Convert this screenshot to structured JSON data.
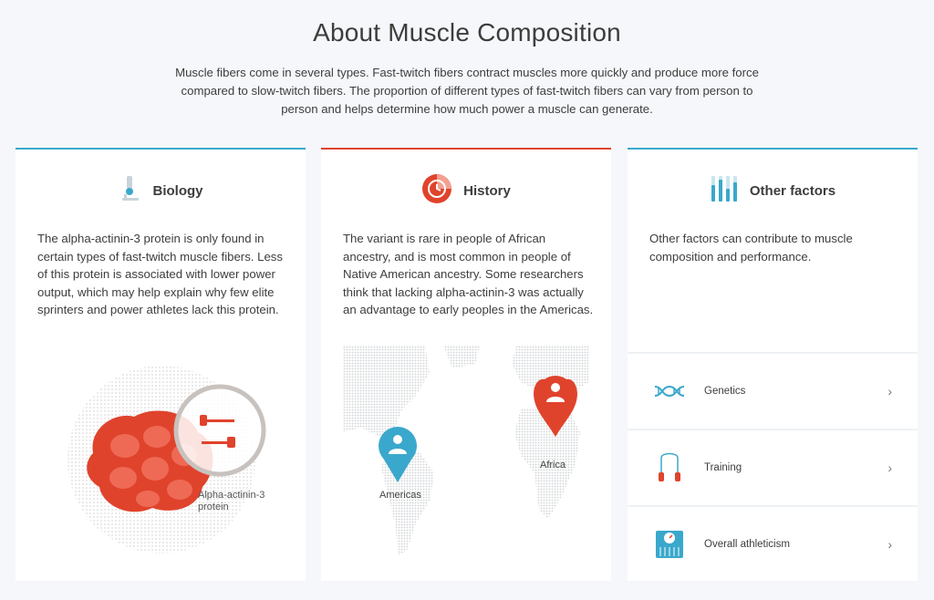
{
  "page": {
    "title": "About Muscle Composition",
    "intro": "Muscle fibers come in several types. Fast-twitch fibers contract muscles more quickly and produce more force compared to slow-twitch fibers. The proportion of different types of fast-twitch fibers can vary from person to person and helps determine how much power a muscle can generate."
  },
  "cards": {
    "biology": {
      "label": "Biology",
      "icon": "microscope-icon",
      "accent": "#3aa8cc",
      "body": "The alpha-actinin-3 protein is only found in certain types of fast-twitch muscle fibers. Less of this protein is associated with lower power output, which may help explain why few elite sprinters and power athletes lack this protein.",
      "illustration_label_1": "Alpha-actinin-3",
      "illustration_label_2": "protein"
    },
    "history": {
      "label": "History",
      "icon": "history-clock-icon",
      "accent": "#e0432c",
      "body": "The variant is rare in people of African ancestry, and is most common in people of Native American ancestry. Some researchers think that lacking alpha-actinin-3 was actually an advantage to early peoples in the Americas.",
      "pin_africa": "Africa",
      "pin_americas": "Americas"
    },
    "other": {
      "label": "Other factors",
      "icon": "bar-levels-icon",
      "accent": "#3aa8cc",
      "body": "Other factors can contribute to muscle composition and performance.",
      "items": [
        {
          "label": "Genetics",
          "icon": "dna-icon"
        },
        {
          "label": "Training",
          "icon": "jump-rope-icon"
        },
        {
          "label": "Overall athleticism",
          "icon": "scale-icon"
        }
      ]
    }
  },
  "colors": {
    "blue": "#3aa8cc",
    "red": "#e0432c",
    "background": "#f5f7fa"
  }
}
